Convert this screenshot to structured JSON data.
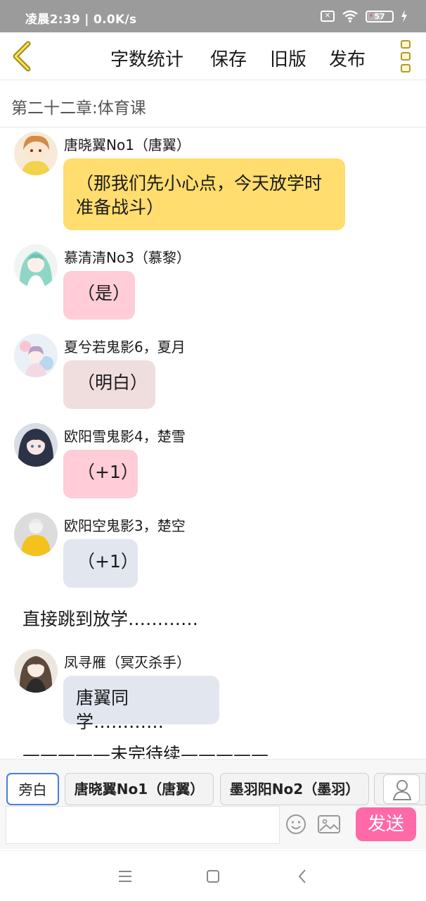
{
  "status_bar": {
    "time_speed": "凌晨2:39 | 0.0K/s",
    "battery": "57"
  },
  "toolbar": {
    "word_count": "字数统计",
    "save": "保存",
    "old_version": "旧版",
    "publish": "发布"
  },
  "chapter_title": "第二十二章:体育课",
  "messages": [
    {
      "name": "唐晓翼No1（唐翼）",
      "text": "（那我们先小心点，今天放学时准备战斗）",
      "bubble_color": "#ffdd6e"
    },
    {
      "name": "慕清清No3（慕黎）",
      "text": "（是）",
      "bubble_color": "#ffccd8"
    },
    {
      "name": "夏兮若鬼影6，夏月",
      "text": "（明白）",
      "bubble_color": "#f0dede"
    },
    {
      "name": "欧阳雪鬼影4，楚雪",
      "text": "（+1）",
      "bubble_color": "#ffccd8"
    },
    {
      "name": "欧阳空鬼影3，楚空",
      "text": "（+1）",
      "bubble_color": "#e1e6ef"
    },
    {
      "name": "凤寻雁（冥灭杀手）",
      "text": "唐翼同学…………",
      "bubble_color": "#e1e6ef"
    }
  ],
  "narration_1": "直接跳到放学…………",
  "narration_2": "—————未完待续—————",
  "roles": {
    "narrator": "旁白",
    "role_1": "唐晓翼No1（唐翼）",
    "role_2": "墨羽阳No2（墨羽）"
  },
  "input": {
    "send_label": "发送"
  },
  "icons": {
    "back": "chevron-left-icon",
    "menu": "more-vertical-icon",
    "emoji": "smiley-icon",
    "image": "image-icon",
    "person": "person-icon"
  },
  "colors": {
    "accent_yellow": "#b39a22",
    "send_pink": "#ff69a7",
    "active_border": "#4a7dd6"
  }
}
